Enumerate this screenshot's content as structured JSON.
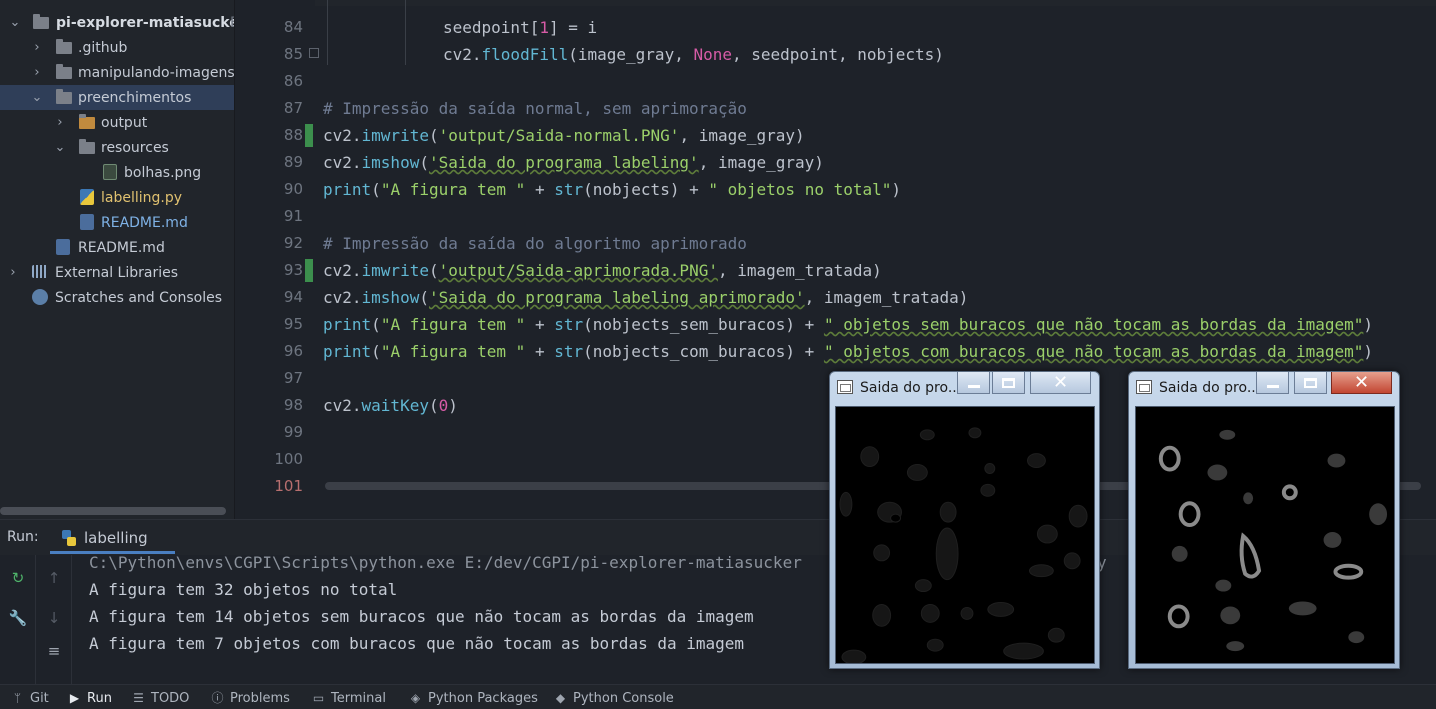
{
  "project_tree": {
    "items": [
      {
        "label": "pi-explorer-matiasucker",
        "suffix": "E"
      },
      {
        "label": ".github"
      },
      {
        "label": "manipulando-imagens"
      },
      {
        "label": "preenchimentos"
      },
      {
        "label": "output"
      },
      {
        "label": "resources"
      },
      {
        "label": "bolhas.png"
      },
      {
        "label": "labelling.py"
      },
      {
        "label": "README.md"
      },
      {
        "label": "README.md"
      },
      {
        "label": "External Libraries"
      },
      {
        "label": "Scratches and Consoles"
      }
    ]
  },
  "editor": {
    "line_numbers": [
      "84",
      "85",
      "86",
      "87",
      "88",
      "89",
      "90",
      "91",
      "92",
      "93",
      "94",
      "95",
      "96",
      "97",
      "98",
      "99",
      "100",
      "101"
    ],
    "code": {
      "l84_a": "seedpoint[",
      "l84_b": "1",
      "l84_c": "] = i",
      "l85_a": "cv2.",
      "l85_b": "floodFill",
      "l85_c": "(image_gray, ",
      "l85_d": "None",
      "l85_e": ", seedpoint, nobjects)",
      "l87": "# Impressão da saída normal, sem aprimoração",
      "l88_a": "cv2.",
      "l88_b": "imwrite",
      "l88_c": "(",
      "l88_d": "'output/Saida-normal.PNG'",
      "l88_e": ", image_gray)",
      "l89_a": "cv2.",
      "l89_b": "imshow",
      "l89_c": "(",
      "l89_d": "'Saida do programa labeling'",
      "l89_e": ", image_gray)",
      "l90_a": "print",
      "l90_b": "(",
      "l90_c": "\"A figura tem \"",
      "l90_d": " + ",
      "l90_e": "str",
      "l90_f": "(nobjects) + ",
      "l90_g": "\" objetos no total\"",
      "l90_h": ")",
      "l92": "# Impressão da saída do algoritmo aprimorado",
      "l93_a": "cv2.",
      "l93_b": "imwrite",
      "l93_c": "(",
      "l93_d": "'output/Saida-aprimorada.PNG'",
      "l93_e": ", imagem_tratada)",
      "l94_a": "cv2.",
      "l94_b": "imshow",
      "l94_c": "(",
      "l94_d": "'Saida do programa labeling aprimorado'",
      "l94_e": ", imagem_tratada)",
      "l95_a": "print",
      "l95_b": "(",
      "l95_c": "\"A figura tem \"",
      "l95_d": " + ",
      "l95_e": "str",
      "l95_f": "(nobjects_sem_buracos) + ",
      "l95_g": "\" objetos sem buracos que não tocam as bordas da imagem\"",
      "l95_h": ")",
      "l96_a": "print",
      "l96_b": "(",
      "l96_c": "\"A figura tem \"",
      "l96_d": " + ",
      "l96_e": "str",
      "l96_f": "(nobjects_com_buracos) + ",
      "l96_g": "\" objetos com buracos que não tocam as bordas da imagem\"",
      "l96_h": ")",
      "l98_a": "cv2.",
      "l98_b": "waitKey",
      "l98_c": "(",
      "l98_d": "0",
      "l98_e": ")"
    }
  },
  "run": {
    "label": "Run:",
    "tab": "labelling",
    "output": [
      "C:\\Python\\envs\\CGPI\\Scripts\\python.exe E:/dev/CGPI/pi-explorer-matiasucker",
      "A figura tem 32 objetos no total",
      "A figura tem 14 objetos sem buracos que não tocam as bordas da imagem",
      "A figura tem 7 objetos com buracos que não tocam as bordas da imagem"
    ],
    "cmd_tail": "y"
  },
  "windows": [
    {
      "title": "Saida do pro..."
    },
    {
      "title": "Saida do pro..."
    }
  ],
  "statusbar": {
    "items": [
      "Git",
      "Run",
      "TODO",
      "Problems",
      "Terminal",
      "Python Packages",
      "Python Console"
    ]
  }
}
